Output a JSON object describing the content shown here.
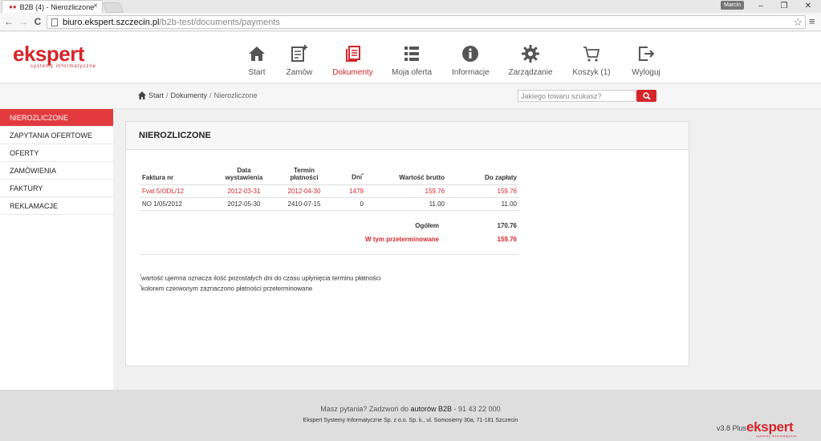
{
  "browser": {
    "tab_title": "B2B (4) - Nierozliczone",
    "tab_close": "×",
    "user": "Marcin",
    "url_host": "biuro.ekspert.szczecin.pl",
    "url_path": "/b2b-test/documents/payments",
    "back_icon": "←",
    "forward_icon": "→",
    "reload_icon": "C",
    "star_icon": "☆",
    "menu_icon": "≡",
    "minimize_icon": "–",
    "restore_icon": "❐",
    "close_icon": "✕"
  },
  "logo": {
    "word": "ekspert",
    "sub": "systemy informatyczne"
  },
  "nav": {
    "items": [
      {
        "label": "Start",
        "icon": "home-icon",
        "active": false
      },
      {
        "label": "Zamów",
        "icon": "order-add-icon",
        "active": false
      },
      {
        "label": "Dokumenty",
        "icon": "documents-icon",
        "active": true
      },
      {
        "label": "Moja oferta",
        "icon": "list-icon",
        "active": false
      },
      {
        "label": "Informacje",
        "icon": "info-icon",
        "active": false
      },
      {
        "label": "Zarządzanie",
        "icon": "gear-icon",
        "active": false
      },
      {
        "label": "Koszyk (1)",
        "icon": "cart-icon",
        "active": false
      },
      {
        "label": "Wyloguj",
        "icon": "logout-icon",
        "active": false
      }
    ]
  },
  "breadcrumb": {
    "home": "Start",
    "sep1": "/",
    "level1": "Dokumenty",
    "sep2": "/",
    "current": "Nierozliczone"
  },
  "search": {
    "placeholder": "Jakiego towaru szukasz?",
    "value": ""
  },
  "sidebar": {
    "items": [
      {
        "label": "NIEROZLICZONE",
        "active": true
      },
      {
        "label": "ZAPYTANIA OFERTOWE",
        "active": false
      },
      {
        "label": "OFERTY",
        "active": false
      },
      {
        "label": "ZAMÓWIENIA",
        "active": false
      },
      {
        "label": "FAKTURY",
        "active": false
      },
      {
        "label": "REKLAMACJE",
        "active": false
      }
    ]
  },
  "panel": {
    "title": "NIEROZLICZONE",
    "columns": {
      "invoice": "Faktura nr",
      "issue_date_1": "Data",
      "issue_date_2": "wystawienia",
      "due_date_1": "Termin",
      "due_date_2": "płatności",
      "days": "Dni",
      "days_mark": "*",
      "gross": "Wartość brutto",
      "to_pay": "Do zapłaty"
    },
    "rows": [
      {
        "invoice": "Fvat 5/ODL/12",
        "issue_date": "2012-03-31",
        "due_date": "2012-04-30",
        "days": "1479",
        "gross": "159.76",
        "to_pay": "159.76",
        "overdue": true
      },
      {
        "invoice": "NO 1/05/2012",
        "issue_date": "2012-05-30",
        "due_date": "2410-07-15",
        "days": "0",
        "gross": "11.00",
        "to_pay": "11.00",
        "overdue": false
      }
    ],
    "total_label": "Ogółem",
    "total_value": "170.76",
    "overdue_label": "W tym przeterminowane",
    "overdue_value": "159.76",
    "note_mark": "*",
    "note1": "wartość ujemna oznacza ilość pozostałych dni do czasu upłynięcia terminu płatności",
    "note2": "kolorem czerwonym zaznaczono płatności przeterminowane"
  },
  "footer": {
    "question_prefix": "Masz pytania? Zadzwoń do",
    "question_link": "autorów B2B",
    "question_suffix": "- 91 43 22 000",
    "company": "Ekspert Systemy Informatyczne Sp. z o.o. Sp. k., ul. Somosierry 30a, 71-181 Szczecin",
    "version": "v3.8 Plus",
    "logo_word": "ekspert",
    "logo_sub": "systemy informatyczne"
  },
  "colors": {
    "accent": "#d4262b",
    "sidebar_active": "#e23a3f"
  }
}
